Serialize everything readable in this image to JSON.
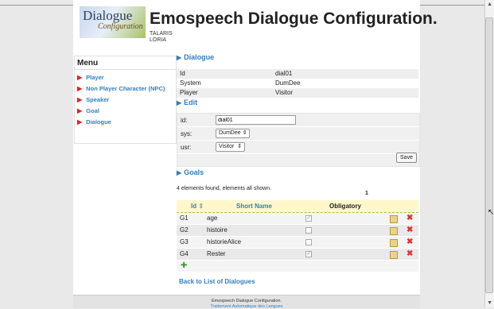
{
  "header": {
    "logo_line1": "Dialogue",
    "logo_line2": "Configuration",
    "title": "Emospeech Dialogue Configuration.",
    "org_line1": "TALARIS",
    "org_line2": "LORIA"
  },
  "menu": {
    "title": "Menu",
    "items": [
      {
        "label": "Player"
      },
      {
        "label": "Non Player Character (NPC)"
      },
      {
        "label": "Speaker"
      },
      {
        "label": "Goal"
      },
      {
        "label": "Dialogue"
      }
    ]
  },
  "dialogue": {
    "heading": "Dialogue",
    "rows": [
      {
        "key": "Id",
        "value": "dial01"
      },
      {
        "key": "System",
        "value": "DumDee"
      },
      {
        "key": "Player",
        "value": "Visitor"
      }
    ]
  },
  "edit": {
    "heading": "Edit",
    "id_label": "id:",
    "id_value": "dial01",
    "sys_label": "sys:",
    "sys_value": "DumDee",
    "usr_label": "usr:",
    "usr_value": "Visitor",
    "save_label": "Save"
  },
  "goals": {
    "heading": "Goals",
    "count_text": "4 elements found, elements all shown.",
    "page_number": "1",
    "columns": {
      "id": "Id",
      "short_name": "Short Name",
      "obligatory": "Obligatory"
    },
    "rows": [
      {
        "id": "G1",
        "name": "age",
        "obligatory": true
      },
      {
        "id": "G2",
        "name": "histoire",
        "obligatory": false
      },
      {
        "id": "G3",
        "name": "historieAlice",
        "obligatory": false
      },
      {
        "id": "G4",
        "name": "Rester",
        "obligatory": true
      }
    ]
  },
  "icons": {
    "section_arrow": "triangle-right-icon",
    "sort": "sort-icon",
    "edit": "edit-icon",
    "delete": "delete-icon",
    "add": "add-icon"
  },
  "back_link": "Back to List of Dialogues",
  "footer": {
    "line1": "Emospeech Dialogue Configuration.",
    "line2": "Traitement Automatique des Langues"
  },
  "colors": {
    "link": "#2f7fbf",
    "menu_arrow": "#dd2222",
    "header_bg": "#fff7c9"
  }
}
